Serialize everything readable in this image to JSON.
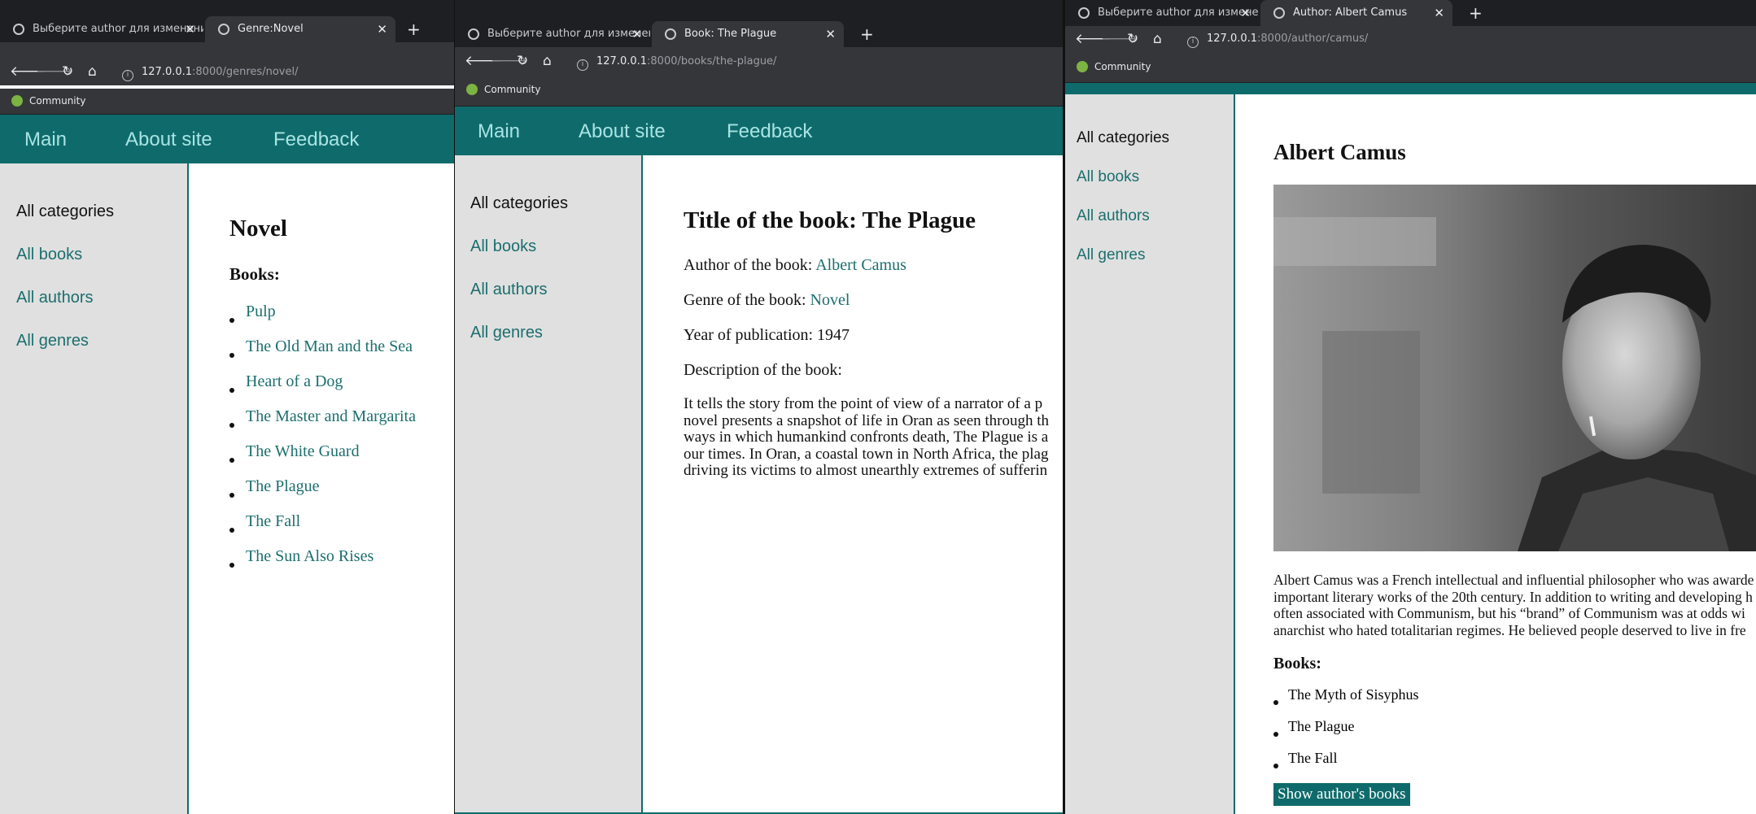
{
  "windows": [
    {
      "tabs": [
        {
          "title": "Выберите author для изменения",
          "active": false
        },
        {
          "title": "Genre:Novel",
          "active": true
        }
      ],
      "url_host": "127.0.0.1",
      "url_rest": ":8000/genres/novel/",
      "bookmark": "Community",
      "nav": [
        "Main",
        "About site",
        "Feedback"
      ],
      "sidebar": {
        "title": "All categories",
        "links": [
          "All books",
          "All authors",
          "All genres"
        ]
      },
      "page": {
        "title": "Novel",
        "books_heading": "Books:",
        "books": [
          "Pulp",
          "The Old Man and the Sea",
          "Heart of a Dog",
          "The Master and Margarita",
          "The White Guard",
          "The Plague",
          "The Fall",
          "The Sun Also Rises"
        ]
      }
    },
    {
      "tabs": [
        {
          "title": "Выберите author для изменения",
          "active": false
        },
        {
          "title": "Book: The Plague",
          "active": true
        }
      ],
      "url_host": "127.0.0.1",
      "url_rest": ":8000/books/the-plague/",
      "bookmark": "Community",
      "nav": [
        "Main",
        "About site",
        "Feedback"
      ],
      "sidebar": {
        "title": "All categories",
        "links": [
          "All books",
          "All authors",
          "All genres"
        ]
      },
      "page": {
        "title": "Title of the book: The Plague",
        "author_label": "Author of the book:",
        "author_value": "Albert Camus",
        "genre_label": "Genre of the book:",
        "genre_value": "Novel",
        "year_line": "Year of publication: 1947",
        "description_label": "Description of the book:",
        "description_lines": [
          "It tells the story from the point of view of a narrator of a p",
          "novel presents a snapshot of life in Oran as seen through th",
          "ways in which humankind confronts death, The Plague is a",
          "our times. In Oran, a coastal town in North Africa, the plag",
          "driving its victims to almost unearthly extremes of sufferin"
        ]
      }
    },
    {
      "tabs": [
        {
          "title": "Выберите author для изменения",
          "active": false
        },
        {
          "title": "Author: Albert Camus",
          "active": true
        }
      ],
      "url_host": "127.0.0.1",
      "url_rest": ":8000/author/camus/",
      "bookmark": "Community",
      "sidebar": {
        "title": "All categories",
        "links": [
          "All books",
          "All authors",
          "All genres"
        ]
      },
      "page": {
        "title": "Albert Camus",
        "bio_lines": [
          "Albert Camus was a French intellectual and influential philosopher who was awarde",
          "important literary works of the 20th century. In addition to writing and developing h",
          "often associated with Communism, but his “brand” of Communism was at odds wi",
          "anarchist who hated totalitarian regimes. He believed people deserved to live in fre"
        ],
        "books_heading": "Books:",
        "books": [
          "The Myth of Sisyphus",
          "The Plague",
          "The Fall"
        ],
        "button": "Show author's books"
      }
    }
  ],
  "colors": {
    "header": "#0f6b6b",
    "nav_text": "#a9e3e3",
    "link": "#1c6e6e",
    "sidebar_bg": "#e0e0e0"
  },
  "icons": [
    "back-arrow-icon",
    "forward-arrow-icon",
    "reload-icon",
    "home-icon",
    "globe-icon",
    "close-icon",
    "info-icon",
    "community-icon"
  ]
}
